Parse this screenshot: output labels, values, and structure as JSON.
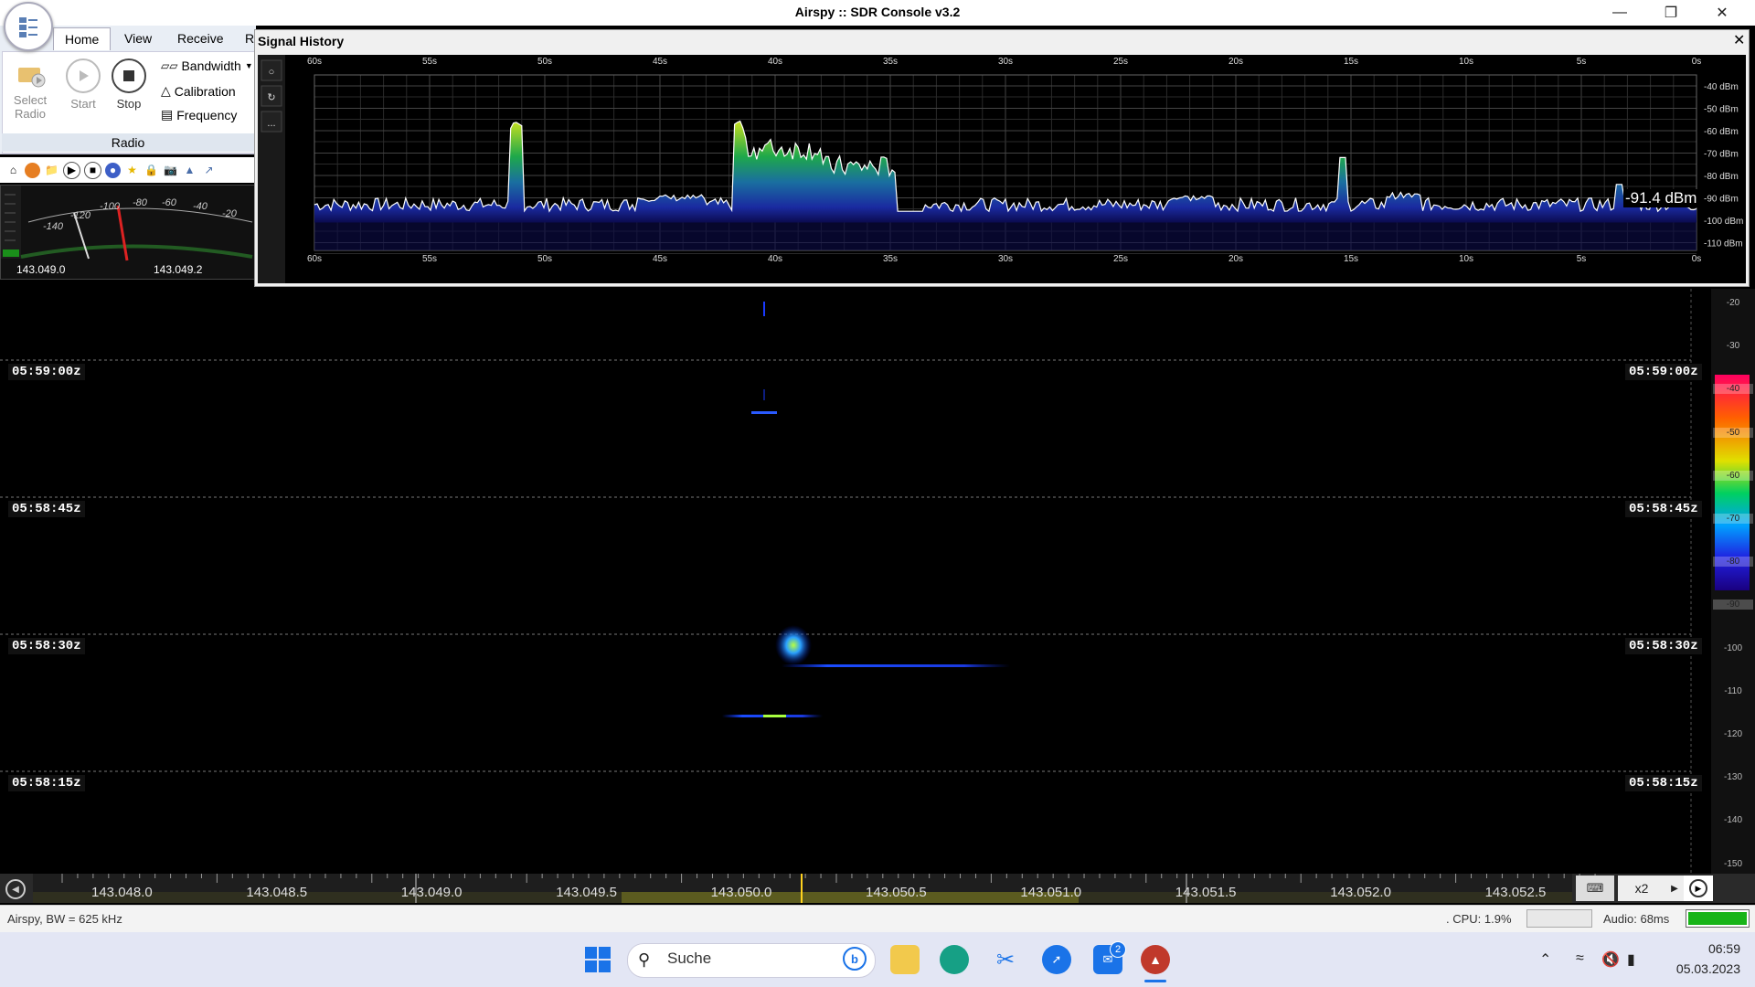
{
  "window": {
    "title": "Airspy :: SDR Console v3.2"
  },
  "ribbon": {
    "tabs": [
      "Home",
      "View",
      "Receive",
      "R"
    ],
    "select_radio": "Select Radio",
    "start": "Start",
    "stop": "Stop",
    "bandwidth": "Bandwidth",
    "calibration": "Calibration",
    "frequency": "Frequency",
    "group_label": "Radio"
  },
  "smeter": {
    "scale": [
      "-140",
      "-120",
      "-100",
      "-80",
      "-60",
      "-40",
      "-20"
    ],
    "freq_left": "143.049.0",
    "freq_right": "143.049.2"
  },
  "signal_history": {
    "title": "Signal History",
    "time_ticks": [
      "60s",
      "55s",
      "50s",
      "45s",
      "40s",
      "35s",
      "30s",
      "25s",
      "20s",
      "15s",
      "10s",
      "5s",
      "0s"
    ],
    "dbm_ticks": [
      "-40 dBm",
      "-50 dBm",
      "-60 dBm",
      "-70 dBm",
      "-80 dBm",
      "-90 dBm",
      "-100 dBm",
      "-110 dBm"
    ],
    "current_level": "-91.4 dBm",
    "side_buttons": [
      "○",
      "↻",
      "..."
    ]
  },
  "waterfall": {
    "time_labels": [
      "05:59:00z",
      "05:58:45z",
      "05:58:30z",
      "05:58:15z"
    ],
    "right_scale": [
      "-20",
      "-30",
      "-40",
      "-50",
      "-60",
      "-70",
      "-80",
      "-90",
      "-100",
      "-110",
      "-120",
      "-130",
      "-140",
      "-150"
    ]
  },
  "freq_axis": {
    "labels": [
      "143.048.0",
      "143.048.5",
      "143.049.0",
      "143.049.5",
      "143.050.0",
      "143.050.5",
      "143.051.0",
      "143.051.5",
      "143.052.0",
      "143.052.5"
    ],
    "zoom": "x2"
  },
  "status": {
    "left": "Airspy, BW = 625 kHz",
    "cpu": ". CPU: 1.9%",
    "audio": "Audio: 68ms"
  },
  "taskbar": {
    "search_placeholder": "Suche",
    "mail_badge": "2",
    "time": "06:59",
    "date": "05.03.2023"
  },
  "colors": {
    "accent": "#ffd21e",
    "sdr_icon": "#c0392b"
  }
}
